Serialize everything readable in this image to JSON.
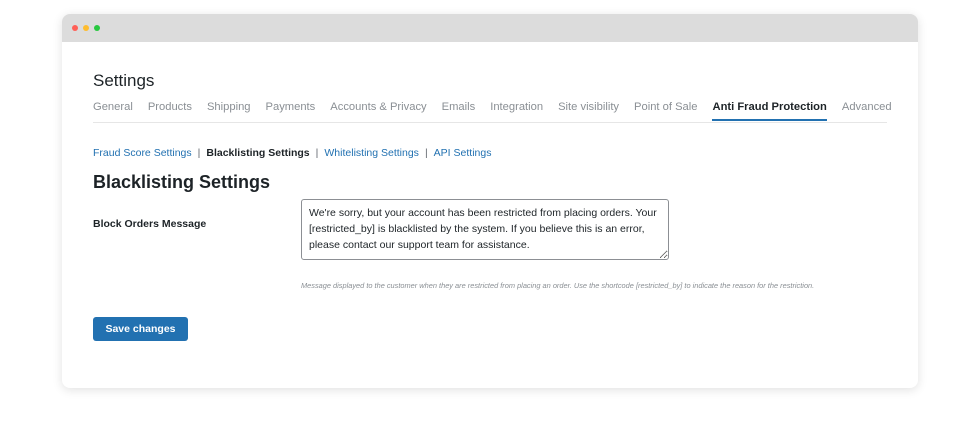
{
  "window": {
    "dots": [
      {
        "name": "close",
        "color": "#ff5f57"
      },
      {
        "name": "minimize",
        "color": "#febc2e"
      },
      {
        "name": "maximize",
        "color": "#28c840"
      }
    ]
  },
  "page": {
    "title": "Settings"
  },
  "main_tabs": [
    {
      "label": "General",
      "active": false
    },
    {
      "label": "Products",
      "active": false
    },
    {
      "label": "Shipping",
      "active": false
    },
    {
      "label": "Payments",
      "active": false
    },
    {
      "label": "Accounts & Privacy",
      "active": false
    },
    {
      "label": "Emails",
      "active": false
    },
    {
      "label": "Integration",
      "active": false
    },
    {
      "label": "Site visibility",
      "active": false
    },
    {
      "label": "Point of Sale",
      "active": false
    },
    {
      "label": "Anti Fraud Protection",
      "active": true
    },
    {
      "label": "Advanced",
      "active": false
    }
  ],
  "sub_tabs": [
    {
      "label": "Fraud Score Settings",
      "active": false
    },
    {
      "label": "Blacklisting Settings",
      "active": true
    },
    {
      "label": "Whitelisting Settings",
      "active": false
    },
    {
      "label": "API Settings",
      "active": false
    }
  ],
  "sub_tab_separator": "|",
  "section": {
    "title": "Blacklisting Settings"
  },
  "block_orders": {
    "label": "Block Orders Message",
    "value": "We're sorry, but your account has been restricted from placing orders. Your [restricted_by] is blacklisted by the system. If you believe this is an error, please contact our support team for assistance.",
    "description": "Message displayed to the customer when they are restricted from placing an order. Use the shortcode [restricted_by] to indicate the reason for the restriction."
  },
  "actions": {
    "save_label": "Save changes"
  },
  "colors": {
    "accent": "#2271b1",
    "text": "#1d2327",
    "muted": "#8a8f94",
    "titlebar": "#dcdcdc"
  }
}
